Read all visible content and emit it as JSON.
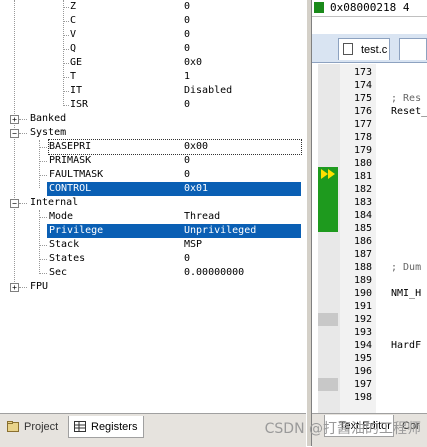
{
  "registers": {
    "flags": [
      {
        "name": "Z",
        "value": "0"
      },
      {
        "name": "C",
        "value": "0"
      },
      {
        "name": "V",
        "value": "0"
      },
      {
        "name": "Q",
        "value": "0"
      },
      {
        "name": "GE",
        "value": "0x0"
      },
      {
        "name": "T",
        "value": "1"
      },
      {
        "name": "IT",
        "value": "Disabled"
      },
      {
        "name": "ISR",
        "value": "0"
      }
    ],
    "banked_label": "Banked",
    "system_label": "System",
    "system": [
      {
        "name": "BASEPRI",
        "value": "0x00"
      },
      {
        "name": "PRIMASK",
        "value": "0"
      },
      {
        "name": "FAULTMASK",
        "value": "0"
      },
      {
        "name": "CONTROL",
        "value": "0x01"
      }
    ],
    "internal_label": "Internal",
    "internal": [
      {
        "name": "Mode",
        "value": "Thread"
      },
      {
        "name": "Privilege",
        "value": "Unprivileged"
      },
      {
        "name": "Stack",
        "value": "MSP"
      },
      {
        "name": "States",
        "value": "0"
      },
      {
        "name": "Sec",
        "value": "0.00000000"
      }
    ],
    "fpu_label": "FPU"
  },
  "bottom_tabs": {
    "project": "Project",
    "registers": "Registers"
  },
  "editor": {
    "address": "0x08000218",
    "address_extra": "4",
    "file_tab": "test.c",
    "line_numbers": [
      "173",
      "174",
      "175",
      "176",
      "177",
      "178",
      "179",
      "180",
      "181",
      "182",
      "183",
      "184",
      "185",
      "186",
      "187",
      "188",
      "189",
      "190",
      "191",
      "192",
      "193",
      "194",
      "195",
      "196",
      "197",
      "198"
    ],
    "code_lines": [
      {
        "line": "175",
        "text": "; Res",
        "comment": true
      },
      {
        "line": "176",
        "text": "Reset_",
        "comment": false
      },
      {
        "line": "188",
        "text": "; Dum",
        "comment": true
      },
      {
        "line": "190",
        "text": "NMI_H",
        "comment": false
      },
      {
        "line": "194",
        "text": "HardF",
        "comment": false
      }
    ],
    "bottom_tab_text_editor": "Text Editor",
    "bottom_tab_cor": "Cor"
  },
  "watermark": "CSDN @打酱油的工程师",
  "colors": {
    "selection": "#0a5fb4",
    "execution_green": "#1e9a1e",
    "arrow_yellow": "#ffe000"
  }
}
